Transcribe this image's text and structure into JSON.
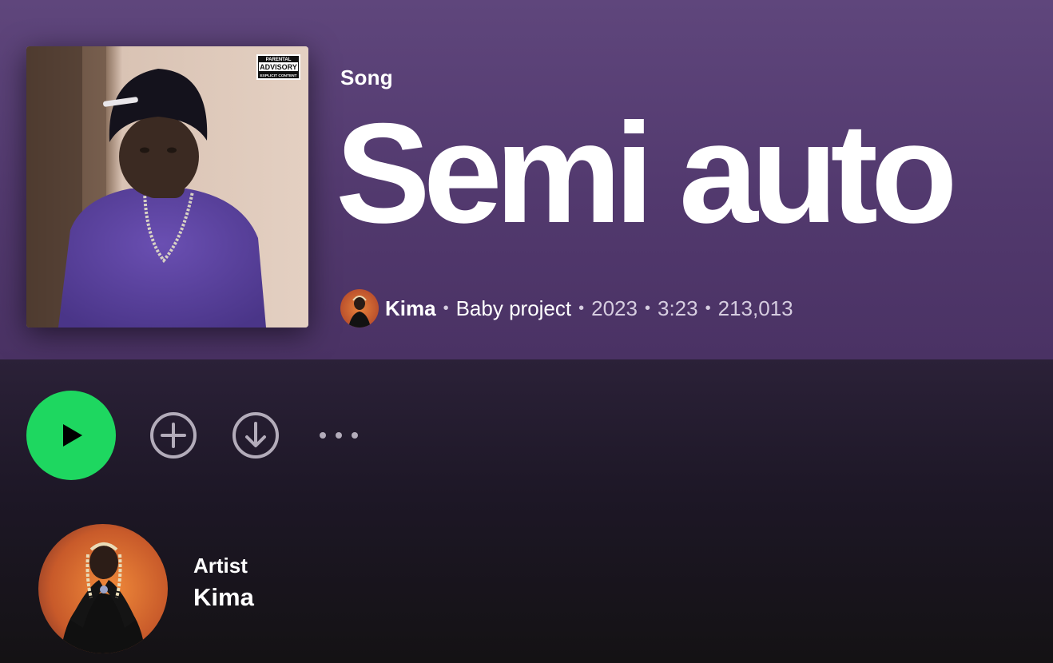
{
  "header": {
    "type_label": "Song",
    "title": "Semi auto",
    "cover_badge": {
      "line1": "PARENTAL",
      "line2": "ADVISORY",
      "line3": "EXPLICIT CONTENT"
    },
    "meta": {
      "artist": "Kima",
      "album": "Baby project",
      "year": "2023",
      "duration": "3:23",
      "plays": "213,013",
      "separator": "•"
    },
    "colors": {
      "gradient_top": "#5f467c",
      "gradient_bottom": "#4a3264"
    }
  },
  "actions": {
    "play_icon": "play-icon",
    "add_icon": "add-circle-icon",
    "download_icon": "download-circle-icon",
    "more_icon": "more-dots-icon",
    "play_color": "#1ed760"
  },
  "artist_card": {
    "kind": "Artist",
    "name": "Kima"
  }
}
